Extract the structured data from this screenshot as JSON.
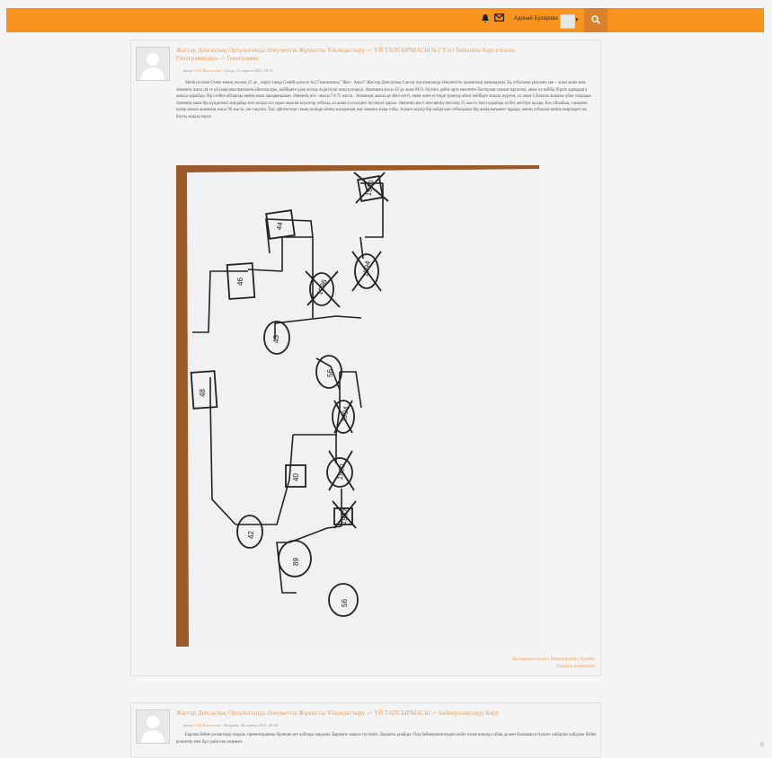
{
  "topbar": {
    "user_name": "Адинай Бухарова",
    "bell_icon": "bell-icon",
    "mail_icon": "mail-icon",
    "search_icon": "search-icon",
    "caret": "▾",
    "accent_color": "#f7931e"
  },
  "posts": [
    {
      "title": "Жастар Денсаулық Орталығында Әлеуметтік Жұмысты Ұйымдастыру -> ҮЙ ТАПСЫРМАСЫ №2 Үлгі бойынша Көрсетілген Генограммаңыз -> Генограмма",
      "meta_prefix": "автор",
      "author": "О.М Жалгасова",
      "meta_date": " - Среда, 21 апреля 2021, 18:51",
      "body": "Менің есімім Осеке менің жасым 22 де , әзірге тапқа Семей қаласы №2 Гимназиясы \"Жас~ Ақыл\" Жастар Денсаулық Сактау орталығында Әлеуметтік қызметкер мамандығы. Бұ отбасыма ұнауына еке ~ анам және мен. Әкемнің жасы 44 те үй шаруашылығымен айналысады, кейбіреге ұзақ жолда жүргізуші жақсы көреді. Анамның жасы 42 де анам М.О. бүгінге дейін орта мектепте бастауыш сынып мұғалімі, анам ол кейбір бірлік адамдарға жақсы қарайды, бір сөзбен айтқанда менің анам ақпарыңызын. Әкемнің ата~ анасы 74-75 жаста . Анамның анасы де әйел кетті, анам және естінде трактор әйелі кейбірге жақсы жүрген, ол анам 5 балалы жаралы үйле отырады. Әкемнің анам бір күнделікті жағдайда көп жолда сол оқып оқыған ахуалтар отбасы, ал анам сол кездегі кісілерге қарсы. Әкемнің әкесі мен менің тектілер 55 жаста тексі қарайды өз бет жетілуе қалды. Бос ойлайын, сонымен қатар әкеміз анамның жасы 90 жаста, екі тақтаға. Тыс әріптестері самақ кезінде менің жасымның жас анамен жаңа тобы. Аллаға шүкір бір пайда көп отбасымыз бір жаңалығымен тұрады, менің отбасым менің өмірімдегі ең басты жақсы нәрсе."
    },
    {
      "title": "Жастар Денсаулық Орталығында Әлеуметтік Жұмысты Ұйымдастыру -> ҮЙ ТАПСЫРМАСЫ -> Бейнероликтерді Көру",
      "meta_prefix": "автор",
      "author": "О.М Жалгасова",
      "meta_date": " - Вторник, 20 апреля 2021, 20:30",
      "body": "Барлық бейне роликтерді көрдім, презентацияны бірнеше рет қайтара оқыдым. Барлығы жақсы түсінікті, барлығы ұнайды. Осы бейнероликтерден кейін өзіме көңілді сабақ да мен болашақта Аллаға сабақтан пайдалы бейне роликтер мен бұл үшін көп оқимын."
    }
  ],
  "post_links": {
    "permalink": "Постоянная ссылка",
    "edit": "Редактировать",
    "delete": "Удалить",
    "sep": "|",
    "show_in_context": "Показать в контексте"
  },
  "genogram": {
    "node_labels": [
      "44",
      "46",
      "1996",
      "42",
      "40",
      "1994",
      "43",
      "56",
      "48",
      "1994",
      "1960",
      "1960",
      "48",
      "1997",
      "89",
      "56"
    ]
  }
}
